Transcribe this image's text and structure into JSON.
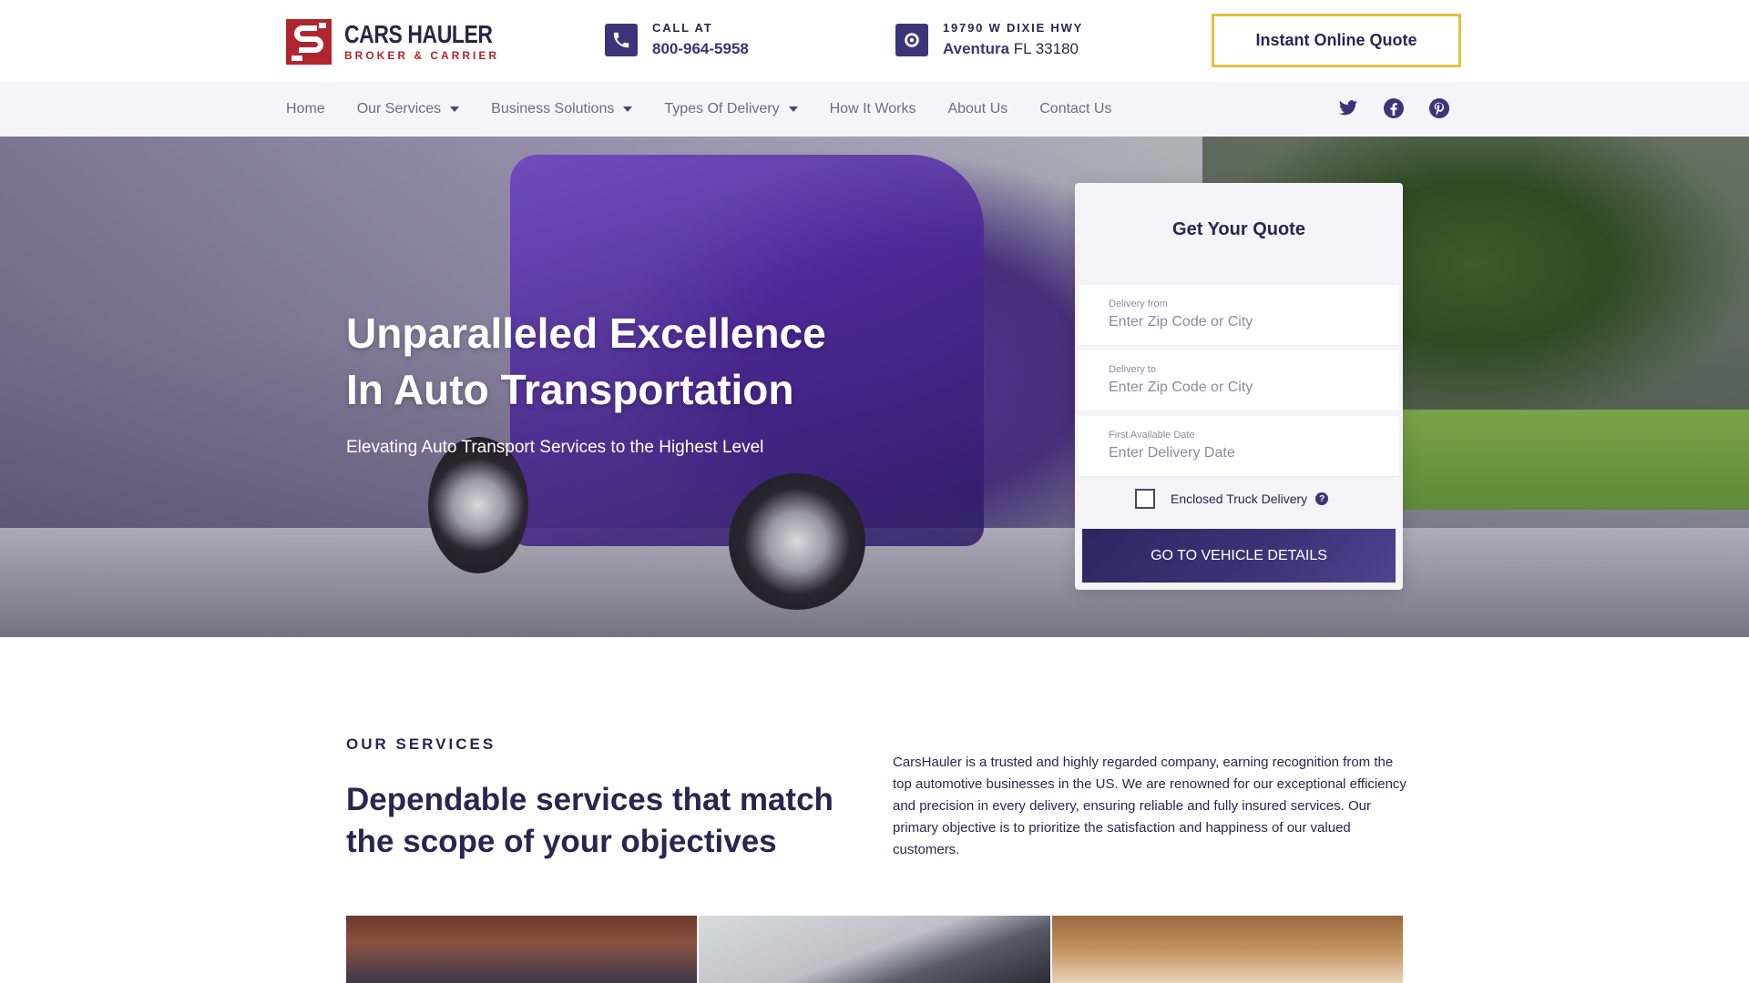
{
  "header": {
    "logo": {
      "name": "CARS HAULER",
      "tagline": "BROKER & CARRIER",
      "brand_color": "#b0262f"
    },
    "call": {
      "label": "CALL AT",
      "phone": "800-964-5958",
      "icon": "phone-icon"
    },
    "address": {
      "street": "19790 W DIXIE HWY",
      "city": "Aventura",
      "state_zip": "FL 33180",
      "icon": "location-pin-icon"
    },
    "cta_label": "Instant Online Quote",
    "cta_border_color": "#e0c23c"
  },
  "nav": {
    "items": [
      {
        "label": "Home",
        "dropdown": false
      },
      {
        "label": "Our Services",
        "dropdown": true
      },
      {
        "label": "Business Solutions",
        "dropdown": true
      },
      {
        "label": "Types Of Delivery",
        "dropdown": true
      },
      {
        "label": "How It Works",
        "dropdown": false
      },
      {
        "label": "About Us",
        "dropdown": false
      },
      {
        "label": "Contact Us",
        "dropdown": false
      }
    ],
    "social": [
      "twitter-icon",
      "facebook-icon",
      "pinterest-icon"
    ]
  },
  "hero": {
    "title_line1": "Unparalleled Excellence",
    "title_line2": "In Auto Transportation",
    "subtitle": "Elevating Auto Transport Services to the Highest Level"
  },
  "quote_form": {
    "title": "Get Your Quote",
    "fields": [
      {
        "label": "Delivery from",
        "placeholder": "Enter Zip Code or City"
      },
      {
        "label": "Delivery to",
        "placeholder": "Enter Zip Code or City"
      },
      {
        "label": "First Available Date",
        "placeholder": "Enter Delivery Date"
      }
    ],
    "checkbox_label": "Enclosed Truck Delivery",
    "checkbox_checked": false,
    "help_glyph": "?",
    "submit_label": "GO TO VEHICLE DETAILS"
  },
  "services": {
    "kicker": "OUR SERVICES",
    "heading": "Dependable services that match the scope of your objectives",
    "description": "CarsHauler is a trusted and highly regarded company, earning recognition from the top automotive businesses in the US. We are renowned for our exceptional efficiency and precision in every delivery, ensuring reliable and fully insured services. Our primary objective is to prioritize the satisfaction and happiness of our valued customers."
  },
  "colors": {
    "primary": "#2a2550",
    "accent": "#3b3478",
    "nav_bg": "#f5f5f9"
  }
}
